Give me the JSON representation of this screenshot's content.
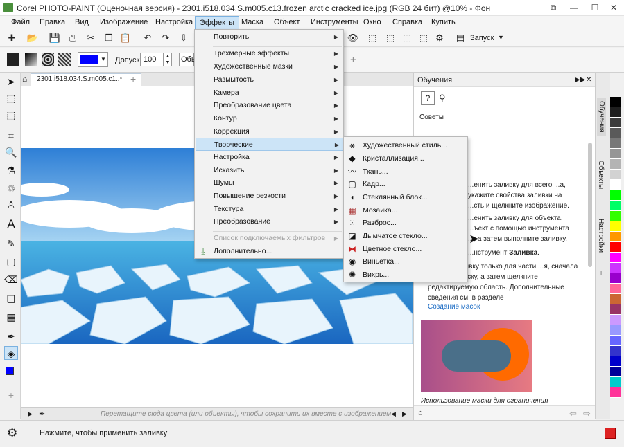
{
  "window": {
    "title": "Corel PHOTO-PAINT (Оценочная версия) - 2301.i518.034.S.m005.c13.frozen arctic cracked ice.jpg (RGB 24 бит) @10% - Фон",
    "min": "—",
    "max": "☐",
    "close": "✕",
    "restore": "⧉"
  },
  "menubar": [
    "Файл",
    "Правка",
    "Вид",
    "Изображение",
    "Настройка",
    "Эффекты",
    "Маска",
    "Объект",
    "Инструменты",
    "Окно",
    "Справка",
    "Купить"
  ],
  "toolbar": {
    "launch_label": "Запуск",
    "tolerance_label": "Допуск:",
    "tolerance_value": "100",
    "partial_label": "Обь"
  },
  "colors": {
    "accent": "#cce4f7",
    "fill": "#0000ff"
  },
  "document": {
    "tab": "2301.i518.034.S.m005.c1..*",
    "add_tab": "+",
    "hint": "Перетащите сюда цвета (или объекты), чтобы сохранить их вместе с изображением"
  },
  "status": {
    "text": "Нажмите, чтобы применить заливку"
  },
  "effects_menu": [
    {
      "label": "Повторить",
      "sub": true
    },
    {
      "label": "Трехмерные эффекты",
      "sub": true
    },
    {
      "label": "Художественные мазки",
      "sub": true
    },
    {
      "label": "Размытость",
      "sub": true
    },
    {
      "label": "Камера",
      "sub": true
    },
    {
      "label": "Преобразование цвета",
      "sub": true
    },
    {
      "label": "Контур",
      "sub": true
    },
    {
      "label": "Коррекция",
      "sub": true
    },
    {
      "label": "Творческие",
      "sub": true
    },
    {
      "label": "Настройка",
      "sub": true
    },
    {
      "label": "Исказить",
      "sub": true
    },
    {
      "label": "Шумы",
      "sub": true
    },
    {
      "label": "Повышение резкости",
      "sub": true
    },
    {
      "label": "Текстура",
      "sub": true
    },
    {
      "label": "Преобразование",
      "sub": true
    },
    {
      "label": "Список подключаемых фильтров",
      "sub": true
    },
    {
      "label": "Дополнительно...",
      "sub": false
    }
  ],
  "creative_menu": [
    "Художественный стиль...",
    "Кристаллизация...",
    "Ткань...",
    "Кадр...",
    "Стеклянный блок...",
    "Мозаика...",
    "Разброс...",
    "Дымчатое стекло...",
    "Цветное стекло...",
    "Виньетка...",
    "Вихрь..."
  ],
  "panel": {
    "title": "Обучения",
    "tips_label": "Советы",
    "p1": "...енить заливку для всего ...а, укажите свойства заливки на ...сть и щелкните изображение.",
    "p2": "...енить заливку для объекта, ...ъект с помощью инструмента ..., а затем выполните заливку.",
    "p3_a": "...нструмент ",
    "p3_b": "Заливка",
    "p3_c": ".",
    "p4": "...енить заливку только для части ...я, сначала создайте маску, а затем щелкните редактируемую область. Дополнительные сведения см. в разделе",
    "link": "Создание масок",
    "caption": "Использование маски для ограничения области"
  },
  "sidetabs": [
    "Обучения",
    "Объекты",
    "Настройки"
  ],
  "palette": [
    "#000000",
    "#1e1e1e",
    "#3c3c3c",
    "#5a5a5a",
    "#787878",
    "#969696",
    "#b4b4b4",
    "#d2d2d2",
    "#ffffff",
    "#00ff00",
    "#00ff66",
    "#33ff00",
    "#ffff00",
    "#ff9900",
    "#ff0000",
    "#ff00ff",
    "#cc33ff",
    "#9900cc",
    "#ff6699",
    "#cc6633",
    "#993366",
    "#cc99ff",
    "#9999ff",
    "#6666ff",
    "#3333cc",
    "#0000cc",
    "#000099",
    "#00cccc",
    "#ff3399"
  ]
}
